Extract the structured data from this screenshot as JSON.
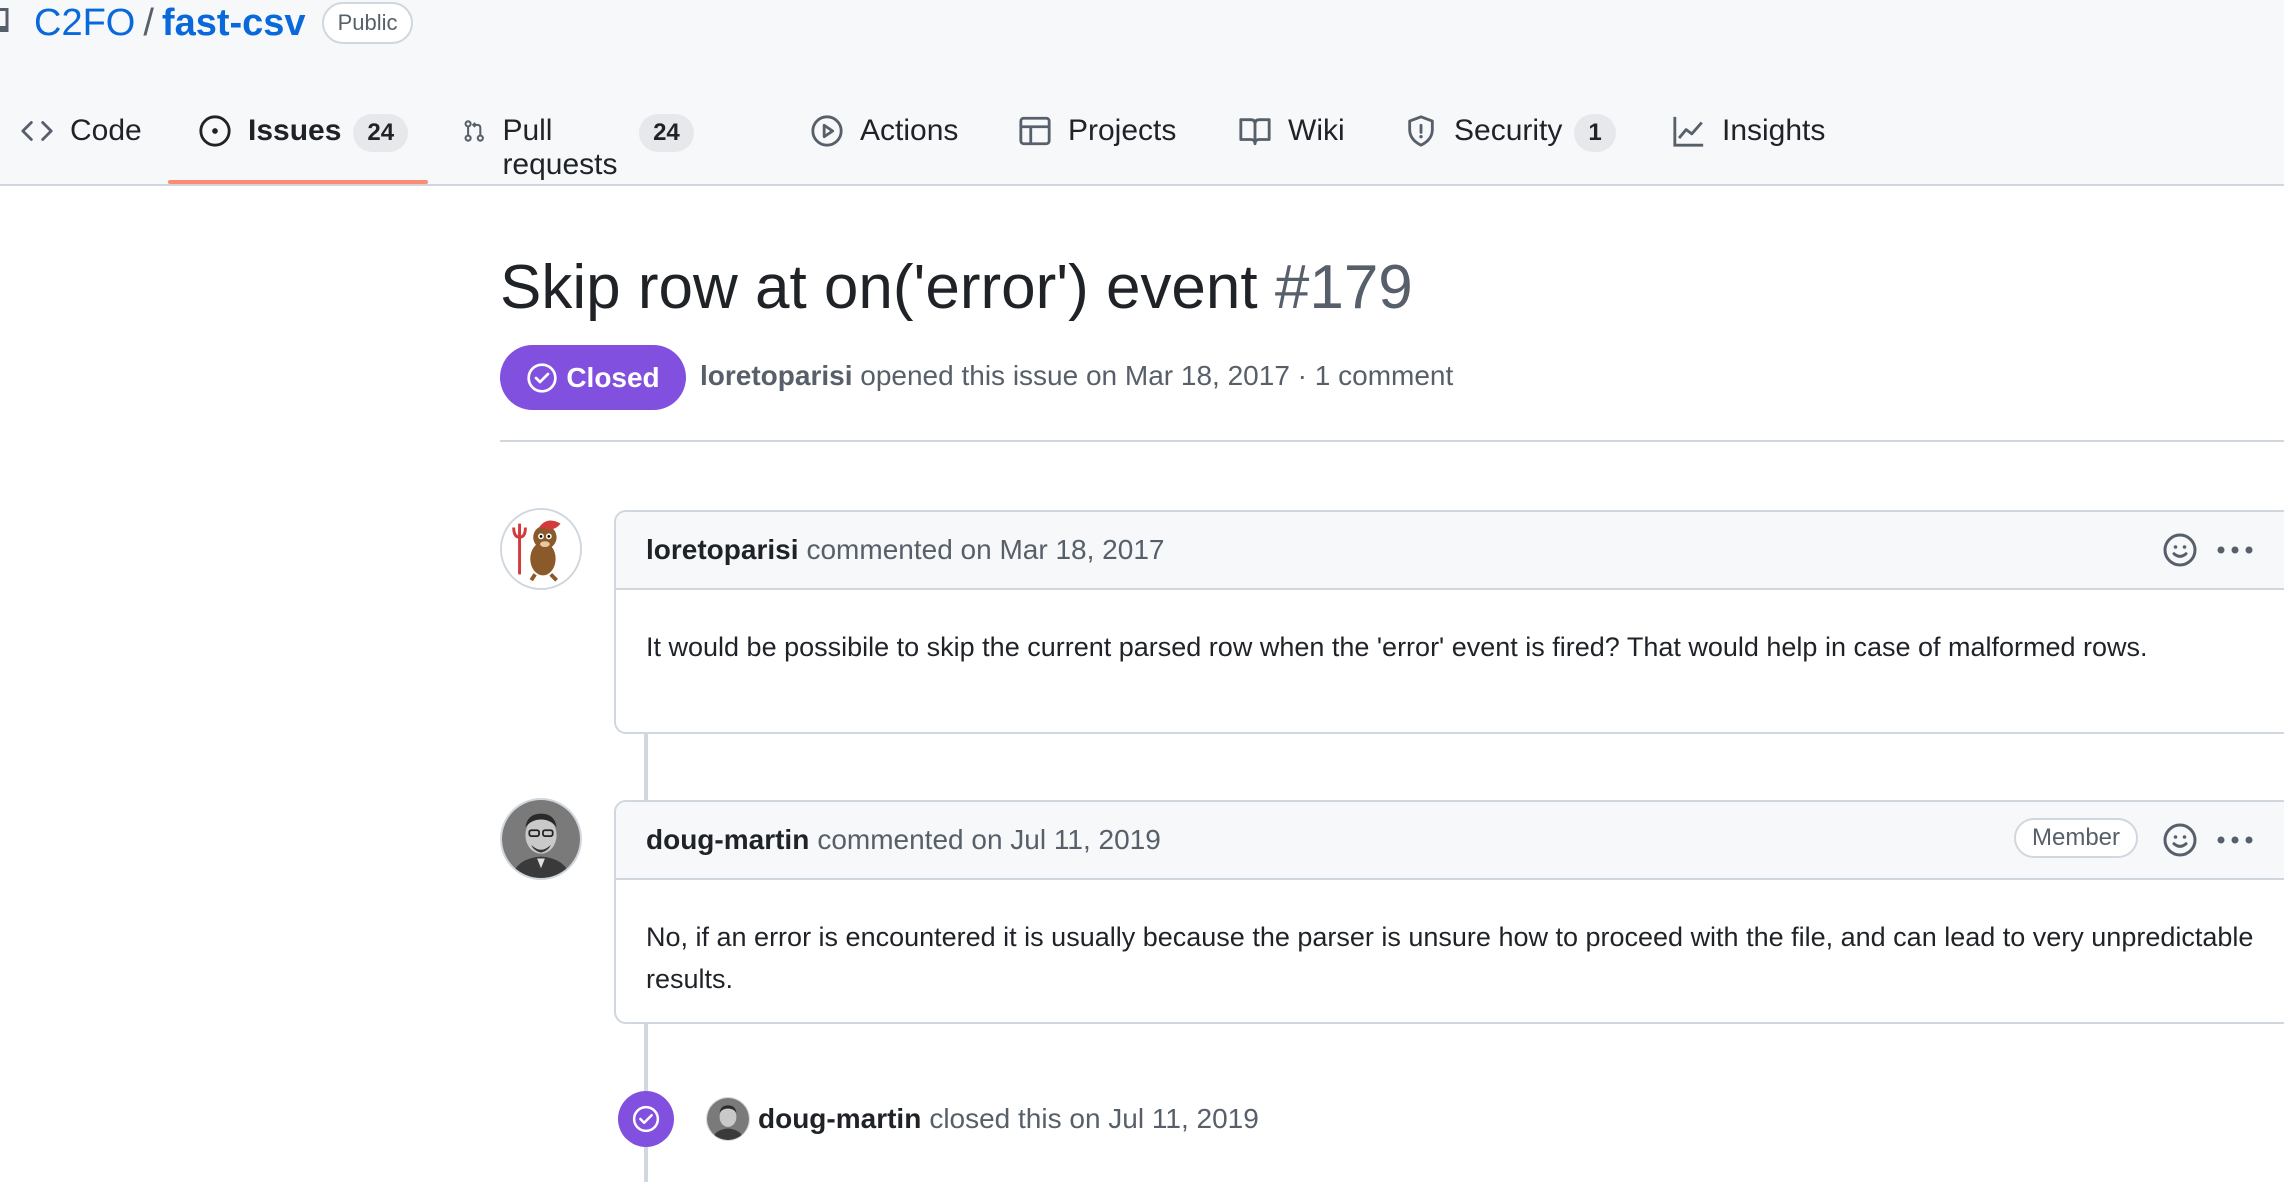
{
  "repo": {
    "owner": "C2FO",
    "separator": "/",
    "name": "fast-csv",
    "visibility": "Public"
  },
  "tabs": [
    {
      "label": "Code",
      "icon": "code-icon"
    },
    {
      "label": "Issues",
      "count": "24",
      "icon": "issue-opened-icon",
      "selected": true
    },
    {
      "label": "Pull requests",
      "count": "24",
      "icon": "git-pull-request-icon"
    },
    {
      "label": "Actions",
      "icon": "play-icon"
    },
    {
      "label": "Projects",
      "icon": "table-icon"
    },
    {
      "label": "Wiki",
      "icon": "book-icon"
    },
    {
      "label": "Security",
      "count": "1",
      "icon": "shield-icon"
    },
    {
      "label": "Insights",
      "icon": "graph-icon"
    }
  ],
  "issue": {
    "title": "Skip row at on('error') event",
    "number": "#179",
    "state": "Closed",
    "author": "loretoparisi",
    "opened_text": "opened this issue on Mar 18, 2017 · 1 comment"
  },
  "comments": [
    {
      "author": "loretoparisi",
      "action": "commented on Mar 18, 2017",
      "body": "It would be possibile to skip the current parsed row when the 'error' event is fired? That would help in case of malformed rows."
    },
    {
      "author": "doug-martin",
      "action": "commented on Jul 11, 2019",
      "badge": "Member",
      "body": "No, if an error is encountered it is usually because the parser is unsure how to proceed with the file, and can lead to very unpredictable results."
    }
  ],
  "closed_event": {
    "actor": "doug-martin",
    "text": "closed this on Jul 11, 2019"
  },
  "colors": {
    "closed_purple": "#8250df",
    "link_blue": "#0969da",
    "tab_underline": "#fd8c73",
    "border": "#d0d7de"
  }
}
